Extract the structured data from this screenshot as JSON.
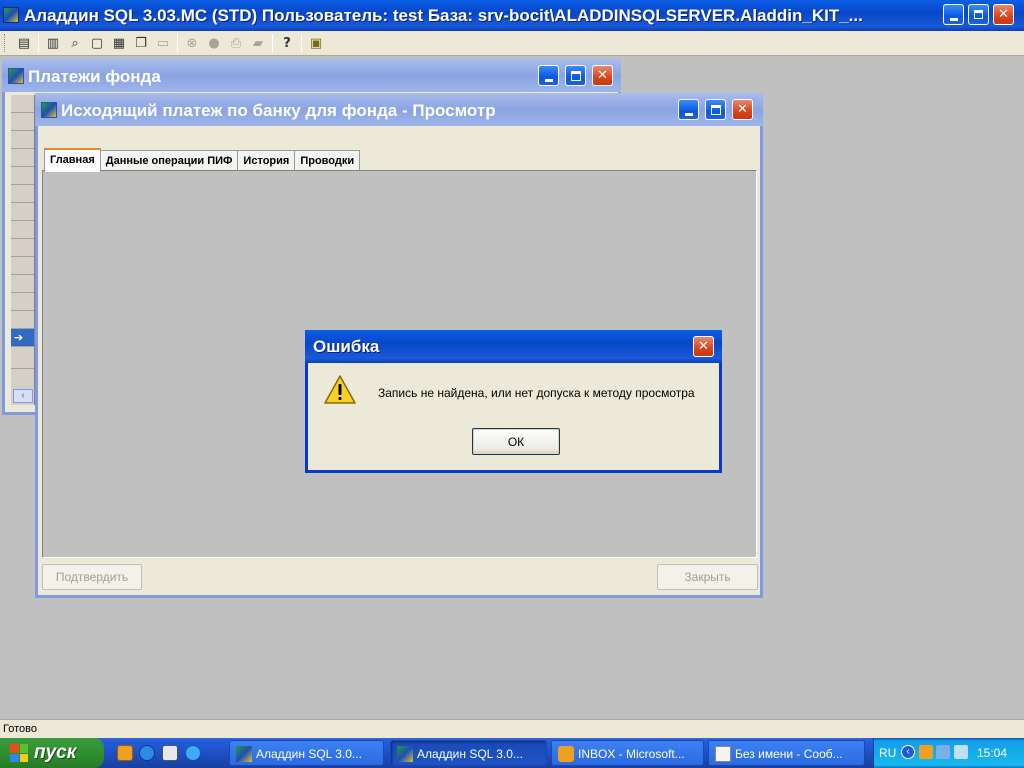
{
  "app": {
    "title": "Аладдин SQL 3.03.МС (STD)  Пользователь: test База: srv-bocit\\ALADDINSQLSERVER.Aladdin_KIT_..."
  },
  "toolbar": {
    "buttons": [
      {
        "name": "list-icon",
        "glyph": "▤",
        "enabled": true
      },
      {
        "name": "open-icon",
        "glyph": "▥",
        "enabled": true
      },
      {
        "name": "find-icon",
        "glyph": "⌕",
        "enabled": true
      },
      {
        "name": "window-icon",
        "glyph": "▢",
        "enabled": true
      },
      {
        "name": "tile-icon",
        "glyph": "▦",
        "enabled": true
      },
      {
        "name": "cascade-icon",
        "glyph": "❐",
        "enabled": true
      },
      {
        "name": "dialog-icon",
        "glyph": "▭",
        "enabled": false
      },
      {
        "name": "binoculars-icon",
        "glyph": "⊗",
        "enabled": false
      },
      {
        "name": "stamp-icon",
        "glyph": "●",
        "enabled": false
      },
      {
        "name": "print-icon",
        "glyph": "⎙",
        "enabled": false
      },
      {
        "name": "export-icon",
        "glyph": "▰",
        "enabled": false
      },
      {
        "name": "help-icon",
        "glyph": "?",
        "enabled": true
      },
      {
        "name": "calculator-icon",
        "glyph": "▣",
        "enabled": true
      }
    ]
  },
  "payments_window": {
    "title": "Платежи фонда",
    "current_row_marker": "➔"
  },
  "payment_window": {
    "title": "Исходящий платеж по банку для фонда - Просмотр",
    "tabs": [
      {
        "label": "Главная",
        "active": true
      },
      {
        "label": "Данные операции ПИФ",
        "active": false
      },
      {
        "label": "История",
        "active": false
      },
      {
        "label": "Проводки",
        "active": false
      }
    ],
    "confirm_label": "Подтвердить",
    "close_label": "Закрыть"
  },
  "error_dialog": {
    "title": "Ошибка",
    "message": "Запись не найдена, или нет допуска к методу просмотра",
    "ok_label": "ОК",
    "close_glyph": "✕"
  },
  "statusbar": {
    "text": "Готово"
  },
  "taskbar": {
    "start_label": "пуск",
    "tasks": [
      {
        "label": "Аладдин SQL 3.0...",
        "active": false
      },
      {
        "label": "Аладдин SQL 3.0...",
        "active": true
      },
      {
        "label": "INBOX - Microsoft...",
        "active": false
      },
      {
        "label": "Без имени - Сооб...",
        "active": false
      }
    ],
    "language": "RU",
    "clock": "15:04"
  },
  "colors": {
    "desktop": "#c0c0c0",
    "active_title": "#0a5fe6",
    "inactive_title": "#8aa4e3",
    "close_red": "#d9451c",
    "taskbar_blue": "#245edb",
    "start_green": "#2f8f2f"
  }
}
